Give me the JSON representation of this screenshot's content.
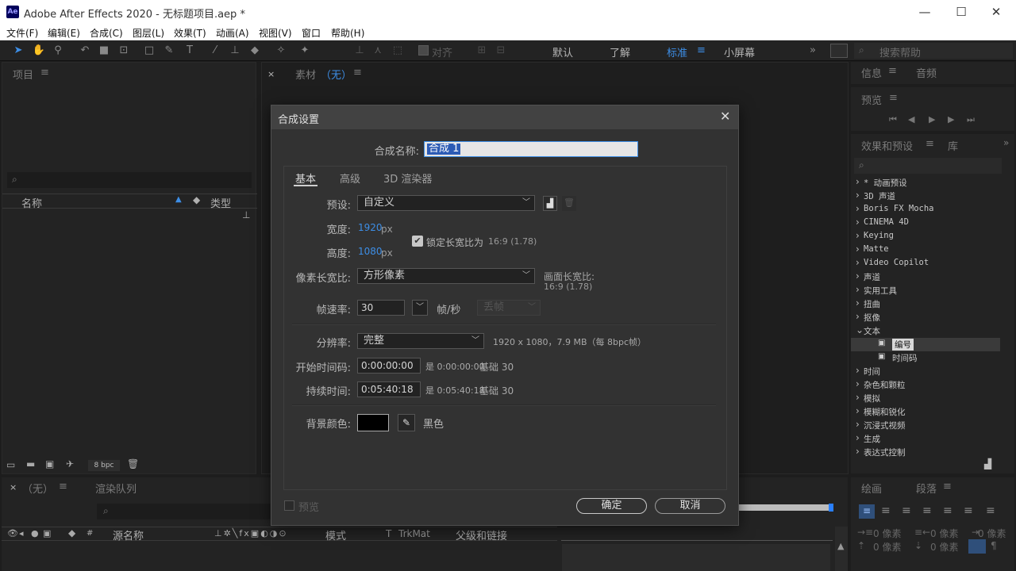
{
  "window": {
    "title": "Adobe After Effects 2020 - 无标题项目.aep *",
    "minimize_glyph": "—",
    "maximize_glyph": "☐",
    "close_glyph": "✕"
  },
  "menu": [
    "文件(F)",
    "编辑(E)",
    "合成(C)",
    "图层(L)",
    "效果(T)",
    "动画(A)",
    "视图(V)",
    "窗口",
    "帮助(H)"
  ],
  "toolbar": {
    "align_label": "对齐",
    "workspaces": [
      "默认",
      "了解",
      "标准",
      "小屏幕"
    ],
    "active_workspace": "标准",
    "more_glyph": "»",
    "search_placeholder": "搜索帮助"
  },
  "project_panel": {
    "title": "项目",
    "search_glyph": "⌕",
    "col_name": "名称",
    "col_type": "类型",
    "bpc": "8 bpc"
  },
  "footage_panel": {
    "title_prefix": "素材",
    "title_value": "（无）"
  },
  "right_panels": {
    "info_tab": "信息",
    "audio_tab": "音频",
    "preview_title": "预览",
    "effects_tab": "效果和预设",
    "library_tab": "库",
    "effects_items": [
      {
        "label": "* 动画预设",
        "open": false
      },
      {
        "label": "3D 声道",
        "open": false
      },
      {
        "label": "Boris FX Mocha",
        "open": false
      },
      {
        "label": "CINEMA 4D",
        "open": false
      },
      {
        "label": "Keying",
        "open": false
      },
      {
        "label": "Matte",
        "open": false
      },
      {
        "label": "Video Copilot",
        "open": false
      },
      {
        "label": "声道",
        "open": false
      },
      {
        "label": "实用工具",
        "open": false
      },
      {
        "label": "扭曲",
        "open": false
      },
      {
        "label": "抠像",
        "open": false
      },
      {
        "label": "文本",
        "open": true
      },
      {
        "label": "编号",
        "child": true,
        "selected": true
      },
      {
        "label": "时间码",
        "child": true
      },
      {
        "label": "时间",
        "open": false
      },
      {
        "label": "杂色和颗粒",
        "open": false
      },
      {
        "label": "模拟",
        "open": false
      },
      {
        "label": "模糊和锐化",
        "open": false
      },
      {
        "label": "沉浸式视频",
        "open": false
      },
      {
        "label": "生成",
        "open": false
      },
      {
        "label": "表达式控制",
        "open": false
      }
    ],
    "paragraph_tab": "段落",
    "drawing_tab": "绘画",
    "indent_labels": [
      "0 像素",
      "0 像素",
      "0 像素",
      "0 像素",
      "0 像素"
    ]
  },
  "timeline": {
    "comp_tab": "（无）",
    "render_queue_tab": "渲染队列",
    "cols": {
      "source_name": "源名称",
      "mode": "模式",
      "t": "T",
      "trkmat": "TrkMat",
      "parent": "父级和链接",
      "hash": "#"
    }
  },
  "dialog": {
    "title": "合成设置",
    "close_glyph": "✕",
    "comp_name_label": "合成名称:",
    "comp_name_value": "合成 1",
    "tabs": [
      "基本",
      "高级",
      "3D 渲染器"
    ],
    "active_tab": "基本",
    "preset_label": "预设:",
    "preset_value": "自定义",
    "width_label": "宽度:",
    "width_value": "1920",
    "height_label": "高度:",
    "height_value": "1080",
    "px_unit": "px",
    "lock_aspect_label": "锁定长宽比为",
    "lock_aspect_value": "16:9 (1.78)",
    "lock_checked": true,
    "pixel_aspect_label": "像素长宽比:",
    "pixel_aspect_value": "方形像素",
    "frame_aspect_label": "画面长宽比:",
    "frame_aspect_value": "16:9 (1.78)",
    "fps_label": "帧速率:",
    "fps_value": "30",
    "fps_unit": "帧/秒",
    "drop_frame_value": "丢帧",
    "resolution_label": "分辨率:",
    "resolution_value": "完整",
    "resolution_info": "1920 x 1080，7.9 MB（每 8bpc帧）",
    "start_tc_label": "开始时间码:",
    "start_tc_value": "0:00:00:00",
    "start_tc_is": "是 0:00:00:00",
    "base_30_a": "基础 30",
    "duration_label": "持续时间:",
    "duration_value": "0:05:40:18",
    "duration_is": "是 0:05:40:18",
    "base_30_b": "基础 30",
    "bg_color_label": "背景颜色:",
    "bg_color_name": "黑色",
    "bg_color": "#000000",
    "preview_label": "预览",
    "ok_label": "确定",
    "cancel_label": "取消"
  },
  "colors": {
    "accent_blue": "#3d8ee6",
    "panel_bg": "#232323",
    "dialog_bg": "#323232"
  }
}
